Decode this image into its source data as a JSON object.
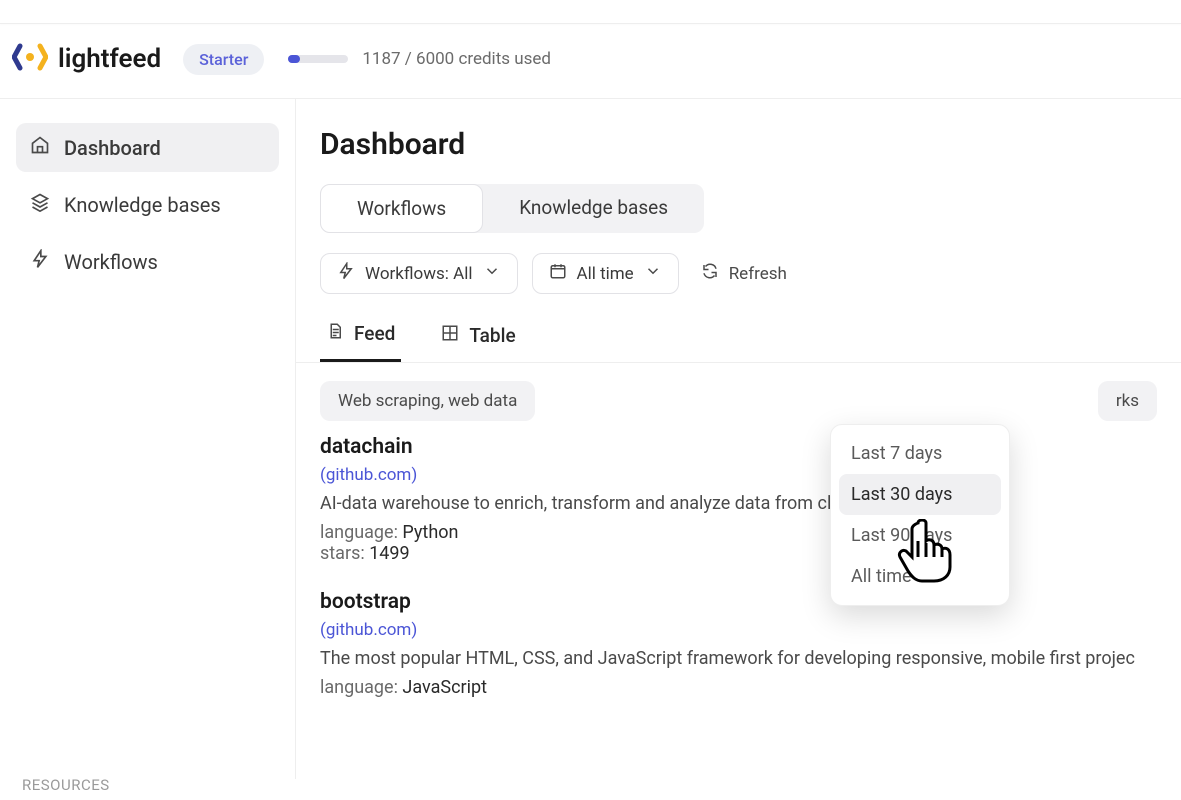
{
  "brand": {
    "name": "lightfeed"
  },
  "plan": {
    "label": "Starter"
  },
  "credits": {
    "text": "1187 / 6000 credits used",
    "pct": 19.8
  },
  "sidebar": {
    "items": [
      {
        "label": "Dashboard",
        "icon": "home"
      },
      {
        "label": "Knowledge bases",
        "icon": "stack"
      },
      {
        "label": "Workflows",
        "icon": "bolt"
      }
    ],
    "resources_heading": "RESOURCES"
  },
  "page": {
    "title": "Dashboard"
  },
  "segmented": {
    "workflows": "Workflows",
    "kb": "Knowledge bases"
  },
  "filters": {
    "workflows": {
      "label": "Workflows: All"
    },
    "time": {
      "label": "All time"
    },
    "refresh": "Refresh"
  },
  "subtabs": {
    "feed": "Feed",
    "table": "Table"
  },
  "tag": {
    "left": "Web scraping, web data",
    "right": "rks"
  },
  "dropdown": {
    "items": [
      {
        "label": "Last 7 days"
      },
      {
        "label": "Last 30 days"
      },
      {
        "label": "Last 90 days"
      },
      {
        "label": "All time"
      }
    ]
  },
  "feed": {
    "items": [
      {
        "title": "datachain",
        "source": "(github.com)",
        "desc": "AI-data warehouse to enrich, transform and analyze data from cloud storages",
        "lang_label": "language:",
        "lang_value": "Python",
        "stars_label": "stars:",
        "stars_value": "1499"
      },
      {
        "title": "bootstrap",
        "source": "(github.com)",
        "desc": "The most popular HTML, CSS, and JavaScript framework for developing responsive, mobile first projec",
        "lang_label": "language:",
        "lang_value": "JavaScript",
        "stars_label": "",
        "stars_value": ""
      }
    ]
  }
}
